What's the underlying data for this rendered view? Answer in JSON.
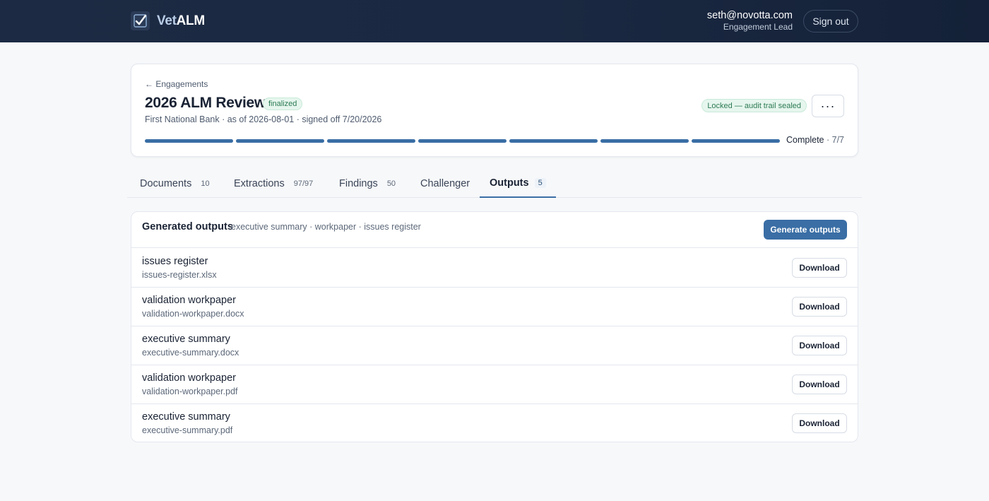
{
  "app": {
    "logo_part1": "Vet",
    "logo_part2": "ALM"
  },
  "user": {
    "email": "seth@novotta.com",
    "role": "Engagement Lead",
    "signout_label": "Sign out"
  },
  "engagement": {
    "back_label": "← Engagements",
    "title": "2026 ALM Review",
    "status_badge": "finalized",
    "subtitle": "First National Bank · as of 2026-08-01 · signed off 7/20/2026",
    "locked_badge": "Locked — audit trail sealed",
    "more_label": "···",
    "progress": {
      "completed_steps": 7,
      "total_steps": 7
    },
    "complete_label": "Complete",
    "complete_count": "· 7/7"
  },
  "tabs": [
    {
      "label": "Documents",
      "count": "10"
    },
    {
      "label": "Extractions",
      "count": "97/97"
    },
    {
      "label": "Findings",
      "count": "50"
    },
    {
      "label": "Challenger",
      "count": ""
    },
    {
      "label": "Outputs",
      "count": "5",
      "active": true
    }
  ],
  "outputs": {
    "title": "Generated outputs",
    "subtitle": "executive summary · workpaper · issues register",
    "generate_label": "Generate outputs",
    "download_label": "Download",
    "rows": [
      {
        "name": "issues register",
        "file": "issues-register.xlsx"
      },
      {
        "name": "validation workpaper",
        "file": "validation-workpaper.docx"
      },
      {
        "name": "executive summary",
        "file": "executive-summary.docx"
      },
      {
        "name": "validation workpaper",
        "file": "validation-workpaper.pdf"
      },
      {
        "name": "executive summary",
        "file": "executive-summary.pdf"
      }
    ]
  },
  "colors": {
    "accent": "#3a6ea5",
    "topbar": "#1c2a43",
    "success_bg": "#e6f6ee",
    "success_text": "#2c7a52"
  }
}
